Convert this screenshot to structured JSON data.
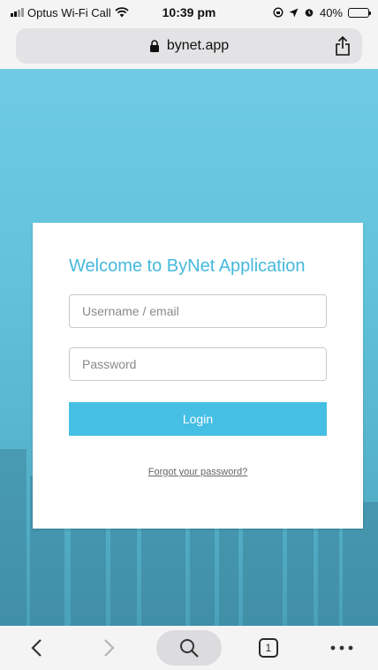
{
  "status_bar": {
    "carrier": "Optus Wi-Fi Call",
    "time": "10:39 pm",
    "battery": "40%",
    "battery_level": 0.4
  },
  "url_bar": {
    "domain": "bynet.app"
  },
  "login_card": {
    "title": "Welcome to ByNet Application",
    "username_placeholder": "Username / email",
    "password_placeholder": "Password",
    "login_label": "Login",
    "forgot_label": "Forgot your password?"
  },
  "toolbar": {
    "tab_count": "1"
  },
  "colors": {
    "accent": "#45bfe4",
    "title": "#45b9dc",
    "background_top": "#6fcbe3",
    "background_bottom": "#4aa1b9"
  },
  "icons": [
    "wifi-icon",
    "lock-icon",
    "share-icon",
    "back-icon",
    "forward-icon",
    "search-icon",
    "tabs-icon",
    "more-icon"
  ]
}
